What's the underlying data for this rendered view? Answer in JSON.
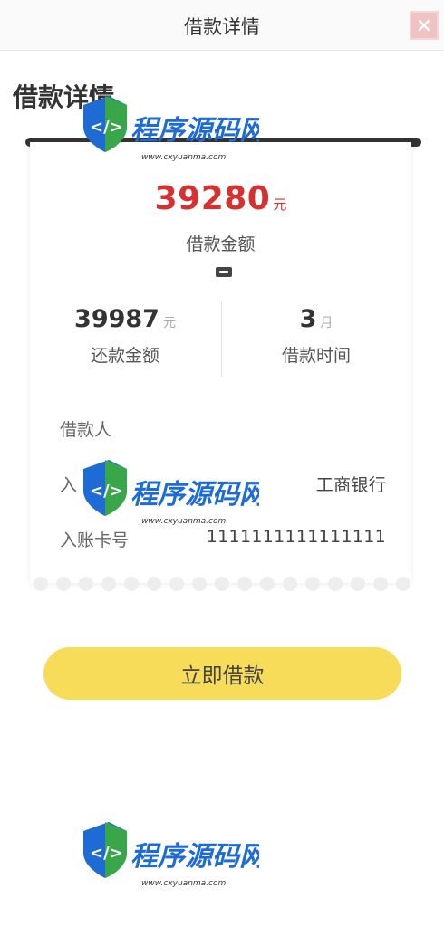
{
  "navbar": {
    "title": "借款详情",
    "close_icon": "close-icon"
  },
  "section": {
    "heading": "借款详情"
  },
  "loan": {
    "amount": "39280",
    "amount_unit": "元",
    "amount_label": "借款金额",
    "ticket_icon": "ticket-icon"
  },
  "stats": {
    "repay_amount": "39987",
    "repay_unit": "元",
    "repay_label": "还款金额",
    "term": "3",
    "term_unit": "月",
    "term_label": "借款时间"
  },
  "details": [
    {
      "label": "借款人",
      "value": ""
    },
    {
      "label": "入",
      "value": "工商银行"
    },
    {
      "label": "入账卡号",
      "value": "1111111111111111"
    }
  ],
  "action": {
    "button_label": "立即借款"
  },
  "watermark": {
    "text": "程序源码网",
    "url": "www.cxyuanma.com"
  },
  "colors": {
    "amount_red": "#d82f2f",
    "button_yellow": "#f7dc5a",
    "watermark_blue": "#1e6bd6",
    "watermark_green": "#3aa64a"
  }
}
